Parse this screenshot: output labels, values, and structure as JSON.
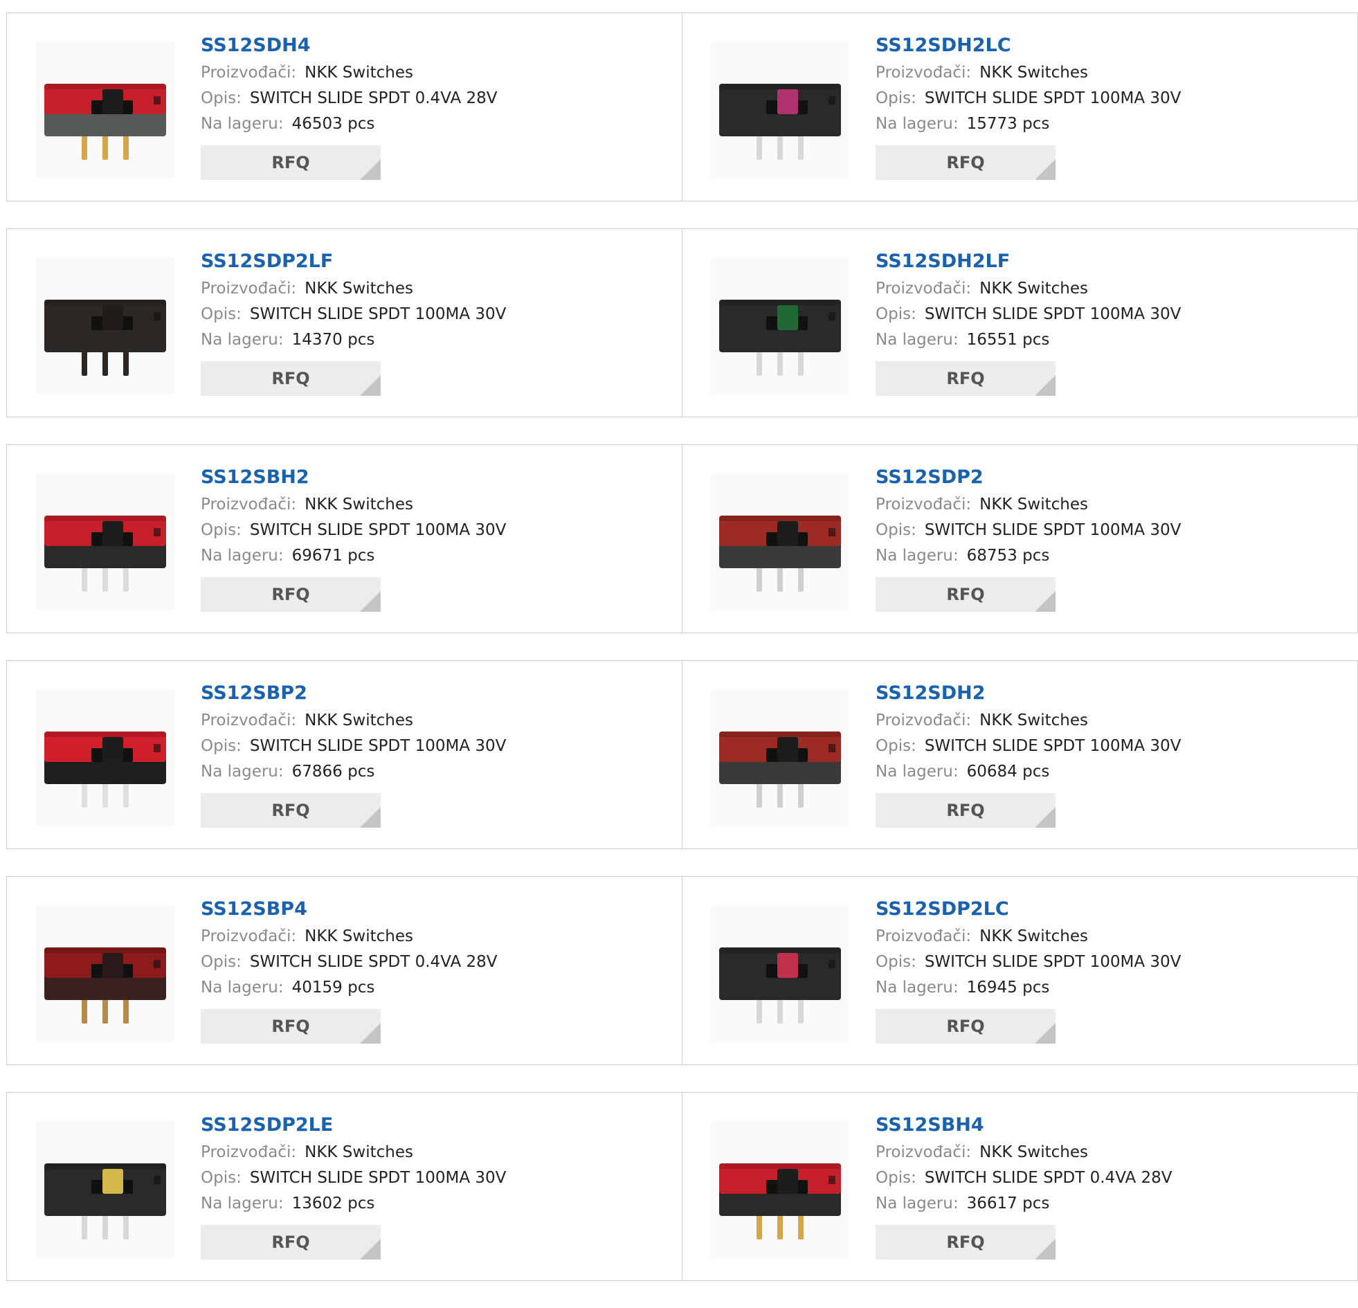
{
  "labels": {
    "manufacturer": "Proizvođači:",
    "description": "Opis:",
    "stock": "Na lageru:",
    "rfq": "RFQ"
  },
  "products": [
    {
      "part": "SS12SDH4",
      "manufacturer": "NKK Switches",
      "description": "SWITCH SLIDE SPDT 0.4VA 28V",
      "stock": "46503 pcs",
      "image": {
        "icon": "slide-switch-image",
        "body": "#c8202a",
        "base": "#555a58",
        "actuator": "#1d1d1d",
        "pins": "#d4a84a"
      }
    },
    {
      "part": "SS12SDH2LC",
      "manufacturer": "NKK Switches",
      "description": "SWITCH SLIDE SPDT 100MA 30V",
      "stock": "15773 pcs",
      "image": {
        "icon": "slide-switch-image",
        "body": "#2a2a2a",
        "base": "#2a2a2a",
        "actuator": "#b0326e",
        "pins": "#d8d8d8"
      }
    },
    {
      "part": "SS12SDP2LF",
      "manufacturer": "NKK Switches",
      "description": "SWITCH SLIDE SPDT 100MA 30V",
      "stock": "14370 pcs",
      "image": {
        "icon": "slide-switch-image",
        "body": "#2b2725",
        "base": "#2b2725",
        "actuator": "#1f1c1a",
        "pins": "#2b2725"
      }
    },
    {
      "part": "SS12SDH2LF",
      "manufacturer": "NKK Switches",
      "description": "SWITCH SLIDE SPDT 100MA 30V",
      "stock": "16551 pcs",
      "image": {
        "icon": "slide-switch-image",
        "body": "#2a2a2a",
        "base": "#2a2a2a",
        "actuator": "#1f6a34",
        "pins": "#d8d8d8"
      }
    },
    {
      "part": "SS12SBH2",
      "manufacturer": "NKK Switches",
      "description": "SWITCH SLIDE SPDT 100MA 30V",
      "stock": "69671 pcs",
      "image": {
        "icon": "slide-switch-image",
        "body": "#c8202a",
        "base": "#2a2a2a",
        "actuator": "#1d1d1d",
        "pins": "#dcdcdc"
      }
    },
    {
      "part": "SS12SDP2",
      "manufacturer": "NKK Switches",
      "description": "SWITCH SLIDE SPDT 100MA 30V",
      "stock": "68753 pcs",
      "image": {
        "icon": "slide-switch-image",
        "body": "#9e2a24",
        "base": "#3a3a3a",
        "actuator": "#1d1d1d",
        "pins": "#cfcfcf"
      }
    },
    {
      "part": "SS12SBP2",
      "manufacturer": "NKK Switches",
      "description": "SWITCH SLIDE SPDT 100MA 30V",
      "stock": "67866 pcs",
      "image": {
        "icon": "slide-switch-image",
        "body": "#d11f2b",
        "base": "#1f1f1f",
        "actuator": "#1d1d1d",
        "pins": "#e0e0e0"
      }
    },
    {
      "part": "SS12SDH2",
      "manufacturer": "NKK Switches",
      "description": "SWITCH SLIDE SPDT 100MA 30V",
      "stock": "60684 pcs",
      "image": {
        "icon": "slide-switch-image",
        "body": "#9e2a24",
        "base": "#3a3a3a",
        "actuator": "#1d1d1d",
        "pins": "#cfcfcf"
      }
    },
    {
      "part": "SS12SBP4",
      "manufacturer": "NKK Switches",
      "description": "SWITCH SLIDE SPDT 0.4VA 28V",
      "stock": "40159 pcs",
      "image": {
        "icon": "slide-switch-image",
        "body": "#8e1b1b",
        "base": "#3a2020",
        "actuator": "#2a1a1a",
        "pins": "#b58a4a"
      }
    },
    {
      "part": "SS12SDP2LC",
      "manufacturer": "NKK Switches",
      "description": "SWITCH SLIDE SPDT 100MA 30V",
      "stock": "16945 pcs",
      "image": {
        "icon": "slide-switch-image",
        "body": "#2a2a2a",
        "base": "#2a2a2a",
        "actuator": "#c0304a",
        "pins": "#d8d8d8"
      }
    },
    {
      "part": "SS12SDP2LE",
      "manufacturer": "NKK Switches",
      "description": "SWITCH SLIDE SPDT 100MA 30V",
      "stock": "13602 pcs",
      "image": {
        "icon": "slide-switch-image",
        "body": "#2a2a2a",
        "base": "#2a2a2a",
        "actuator": "#d4b84a",
        "pins": "#d8d8d8"
      }
    },
    {
      "part": "SS12SBH4",
      "manufacturer": "NKK Switches",
      "description": "SWITCH SLIDE SPDT 0.4VA 28V",
      "stock": "36617 pcs",
      "image": {
        "icon": "slide-switch-image",
        "body": "#c8202a",
        "base": "#2a2a2a",
        "actuator": "#1d1d1d",
        "pins": "#d4a84a"
      }
    }
  ]
}
